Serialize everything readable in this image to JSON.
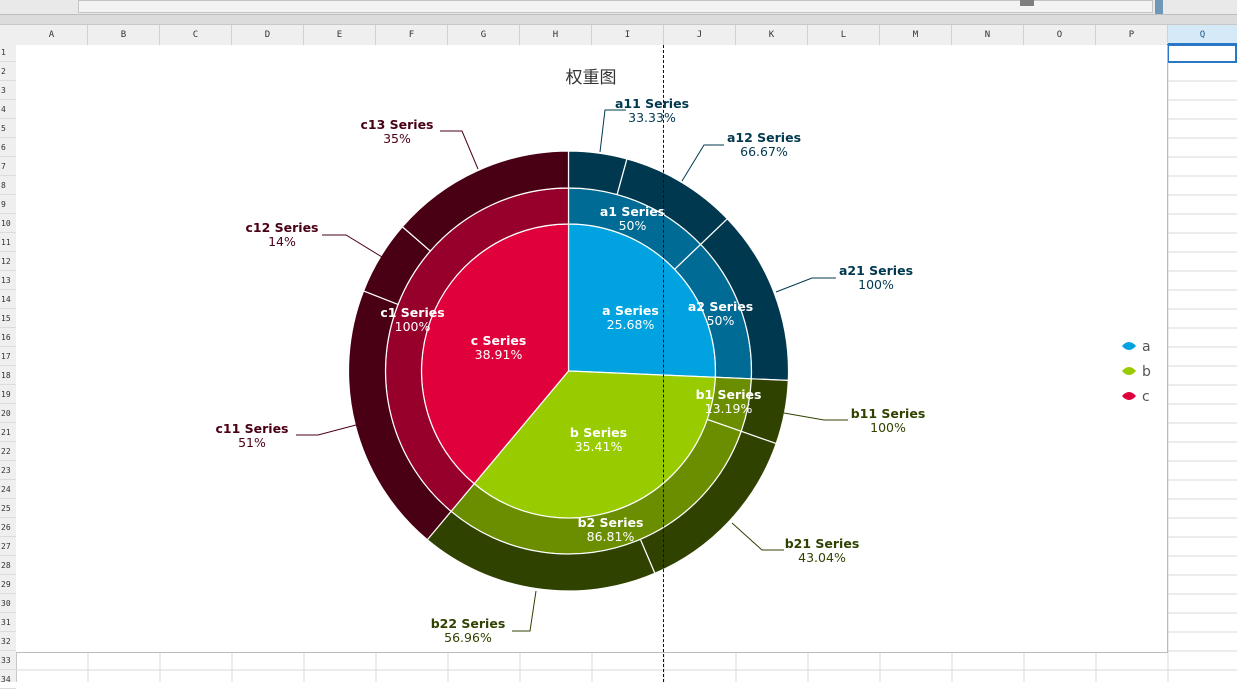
{
  "columns": [
    "A",
    "B",
    "C",
    "D",
    "E",
    "F",
    "G",
    "H",
    "I",
    "J",
    "K",
    "L",
    "M",
    "N",
    "O",
    "P",
    "Q"
  ],
  "selected_column": "Q",
  "rows": [
    "1",
    "2",
    "3",
    "4",
    "5",
    "6",
    "7",
    "8",
    "9",
    "10",
    "11",
    "12",
    "13",
    "14",
    "15",
    "16",
    "17",
    "18",
    "19",
    "20",
    "21",
    "22",
    "23",
    "24",
    "25",
    "26",
    "27",
    "28",
    "29",
    "30",
    "31",
    "32",
    "33",
    "34"
  ],
  "corner_icon": "select-all-icon",
  "colors": {
    "a": "#00A3E0",
    "a1": "#006B94",
    "a2": "#006B94",
    "a_outer": "#00384F",
    "b": "#99CC00",
    "b1": "#6B8E00",
    "b2": "#6B8E00",
    "b_outer": "#2F4200",
    "c": "#E0003C",
    "c1": "#96002B",
    "c_outer": "#4A0014",
    "label_a": "#00384F",
    "label_b": "#2F4200",
    "label_c": "#4A0014"
  },
  "chart_data": {
    "type": "pie",
    "title": "权重图",
    "legend": {
      "placement": "right",
      "entries": [
        "a",
        "b",
        "c"
      ]
    },
    "rings": [
      {
        "ring": "inner",
        "slices": [
          {
            "name": "a",
            "label": "a  Series",
            "percent": "25.68%",
            "value": 25.68,
            "group": "a"
          },
          {
            "name": "b",
            "label": "b  Series",
            "percent": "35.41%",
            "value": 35.41,
            "group": "b"
          },
          {
            "name": "c",
            "label": "c  Series",
            "percent": "38.91%",
            "value": 38.91,
            "group": "c"
          }
        ]
      },
      {
        "ring": "middle",
        "slices": [
          {
            "name": "a1",
            "label": "a1  Series",
            "percent": "50%",
            "value": 12.84,
            "group": "a"
          },
          {
            "name": "a2",
            "label": "a2  Series",
            "percent": "50%",
            "value": 12.84,
            "group": "a"
          },
          {
            "name": "b1",
            "label": "b1  Series",
            "percent": "13.19%",
            "value": 4.67,
            "group": "b"
          },
          {
            "name": "b2",
            "label": "b2  Series",
            "percent": "86.81%",
            "value": 30.74,
            "group": "b"
          },
          {
            "name": "c1",
            "label": "c1  Series",
            "percent": "100%",
            "value": 38.91,
            "group": "c"
          }
        ]
      },
      {
        "ring": "outer",
        "slices": [
          {
            "name": "a11",
            "label": "a11  Series",
            "percent": "33.33%",
            "value": 4.28,
            "group": "a"
          },
          {
            "name": "a12",
            "label": "a12  Series",
            "percent": "66.67%",
            "value": 8.56,
            "group": "a"
          },
          {
            "name": "a21",
            "label": "a21  Series",
            "percent": "100%",
            "value": 12.84,
            "group": "a"
          },
          {
            "name": "b11",
            "label": "b11  Series",
            "percent": "100%",
            "value": 4.67,
            "group": "b"
          },
          {
            "name": "b21",
            "label": "b21  Series",
            "percent": "43.04%",
            "value": 13.23,
            "group": "b"
          },
          {
            "name": "b22",
            "label": "b22  Series",
            "percent": "56.96%",
            "value": 17.51,
            "group": "b"
          },
          {
            "name": "c11",
            "label": "c11  Series",
            "percent": "51%",
            "value": 19.84,
            "group": "c"
          },
          {
            "name": "c12",
            "label": "c12  Series",
            "percent": "14%",
            "value": 5.45,
            "group": "c"
          },
          {
            "name": "c13",
            "label": "c13  Series",
            "percent": "35%",
            "value": 13.62,
            "group": "c"
          }
        ]
      }
    ]
  }
}
